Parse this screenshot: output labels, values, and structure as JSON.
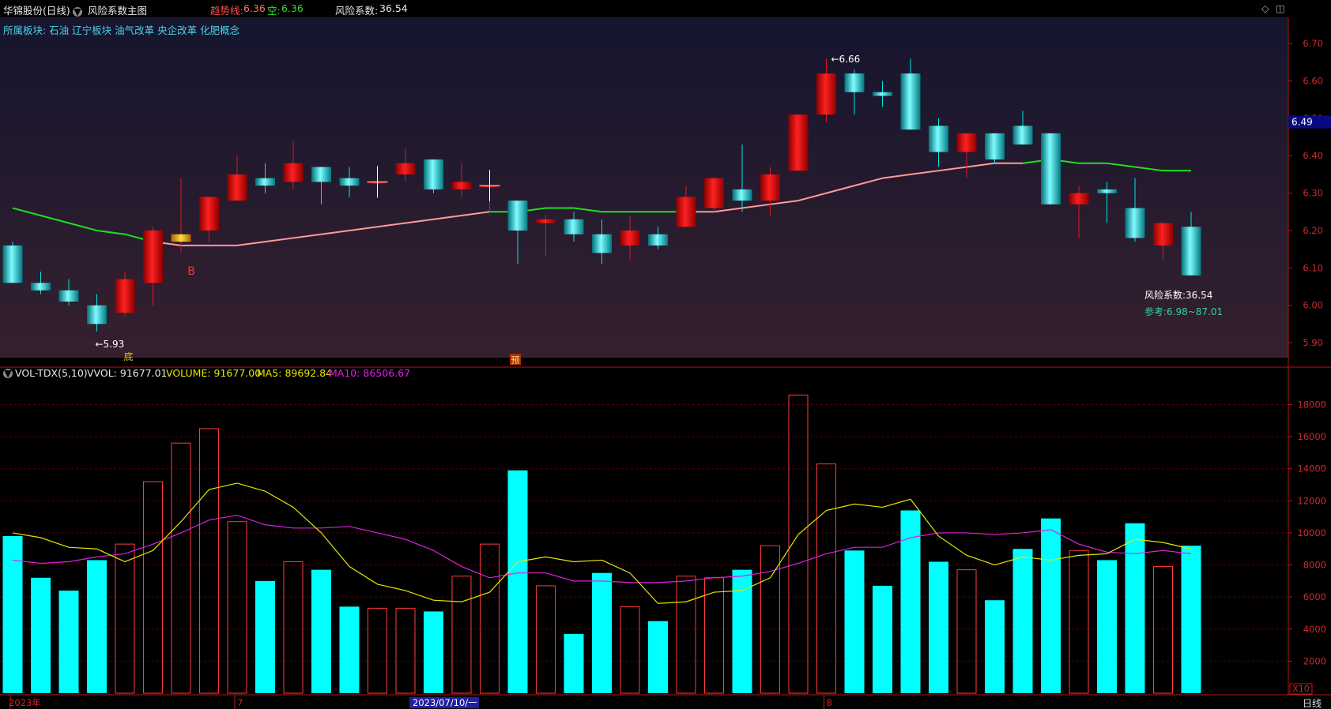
{
  "header": {
    "stock": "华锦股份(日线)",
    "indicator": "风险系数主图",
    "trend_label": "趋势线:",
    "trend_value": "6.36",
    "short_label": "空:",
    "short_value": "6.36",
    "risk_label": "风险系数:",
    "risk_value": "36.54"
  },
  "sectors": "所属板块:  石油  辽宁板块  油气改革  央企改革  化肥概念",
  "vol_header": {
    "name": "VOL-TDX(5,10)",
    "vvol": "VVOL: 91677.01",
    "volume": "VOLUME: 91677.00",
    "ma5": "MA5: 89692.84",
    "ma10": "MA10: 86506.67"
  },
  "colors": {
    "up": "#e01818",
    "down": "#00e6e6",
    "vol_up": "#ff3b3b",
    "vol_down": "#00ffff",
    "trend_up": "#ff9a9a",
    "trend_down": "#22dd22",
    "ma5": "#e6e600",
    "ma10": "#e020e0",
    "axis": "#c01818"
  },
  "chart_data": [
    {
      "type": "candlestick",
      "y_ticks": [
        5.9,
        6.0,
        6.1,
        6.2,
        6.3,
        6.4,
        6.5,
        6.6,
        6.7
      ],
      "ylim": [
        5.86,
        6.77
      ],
      "last_price_label": "6.49",
      "candles": [
        {
          "o": 6.16,
          "h": 6.17,
          "l": 6.06,
          "c": 6.06
        },
        {
          "o": 6.06,
          "h": 6.09,
          "l": 6.03,
          "c": 6.04
        },
        {
          "o": 6.04,
          "h": 6.07,
          "l": 6.0,
          "c": 6.01
        },
        {
          "o": 6.0,
          "h": 6.03,
          "l": 5.93,
          "c": 5.95
        },
        {
          "o": 5.98,
          "h": 6.09,
          "l": 5.97,
          "c": 6.07
        },
        {
          "o": 6.06,
          "h": 6.21,
          "l": 6.0,
          "c": 6.2
        },
        {
          "o": 6.17,
          "h": 6.34,
          "l": 6.14,
          "c": 6.19
        },
        {
          "o": 6.2,
          "h": 6.29,
          "l": 6.17,
          "c": 6.29
        },
        {
          "o": 6.28,
          "h": 6.4,
          "l": 6.28,
          "c": 6.35
        },
        {
          "o": 6.34,
          "h": 6.38,
          "l": 6.3,
          "c": 6.32
        },
        {
          "o": 6.33,
          "h": 6.44,
          "l": 6.31,
          "c": 6.38
        },
        {
          "o": 6.37,
          "h": 6.37,
          "l": 6.27,
          "c": 6.33
        },
        {
          "o": 6.34,
          "h": 6.37,
          "l": 6.29,
          "c": 6.32
        },
        {
          "o": 6.33,
          "h": 6.36,
          "l": 6.29,
          "c": 6.33
        },
        {
          "o": 6.35,
          "h": 6.42,
          "l": 6.33,
          "c": 6.38
        },
        {
          "o": 6.39,
          "h": 6.39,
          "l": 6.3,
          "c": 6.31
        },
        {
          "o": 6.31,
          "h": 6.38,
          "l": 6.29,
          "c": 6.33
        },
        {
          "o": 6.32,
          "h": 6.36,
          "l": 6.25,
          "c": 6.32
        },
        {
          "o": 6.28,
          "h": 6.28,
          "l": 6.11,
          "c": 6.2
        },
        {
          "o": 6.22,
          "h": 6.24,
          "l": 6.13,
          "c": 6.23
        },
        {
          "o": 6.23,
          "h": 6.25,
          "l": 6.17,
          "c": 6.19
        },
        {
          "o": 6.19,
          "h": 6.23,
          "l": 6.11,
          "c": 6.14
        },
        {
          "o": 6.16,
          "h": 6.24,
          "l": 6.12,
          "c": 6.2
        },
        {
          "o": 6.19,
          "h": 6.21,
          "l": 6.15,
          "c": 6.16
        },
        {
          "o": 6.21,
          "h": 6.32,
          "l": 6.21,
          "c": 6.29
        },
        {
          "o": 6.26,
          "h": 6.31,
          "l": 6.25,
          "c": 6.34
        },
        {
          "o": 6.31,
          "h": 6.43,
          "l": 6.25,
          "c": 6.28
        },
        {
          "o": 6.28,
          "h": 6.37,
          "l": 6.24,
          "c": 6.35
        },
        {
          "o": 6.36,
          "h": 6.51,
          "l": 6.36,
          "c": 6.51
        },
        {
          "o": 6.51,
          "h": 6.66,
          "l": 6.49,
          "c": 6.62
        },
        {
          "o": 6.62,
          "h": 6.63,
          "l": 6.51,
          "c": 6.57
        },
        {
          "o": 6.57,
          "h": 6.6,
          "l": 6.53,
          "c": 6.56
        },
        {
          "o": 6.62,
          "h": 6.66,
          "l": 6.47,
          "c": 6.47
        },
        {
          "o": 6.48,
          "h": 6.5,
          "l": 6.37,
          "c": 6.41
        },
        {
          "o": 6.41,
          "h": 6.46,
          "l": 6.34,
          "c": 6.46
        },
        {
          "o": 6.46,
          "h": 6.46,
          "l": 6.38,
          "c": 6.39
        },
        {
          "o": 6.48,
          "h": 6.52,
          "l": 6.43,
          "c": 6.43
        },
        {
          "o": 6.46,
          "h": 6.46,
          "l": 6.27,
          "c": 6.27
        },
        {
          "o": 6.27,
          "h": 6.32,
          "l": 6.18,
          "c": 6.3
        },
        {
          "o": 6.31,
          "h": 6.33,
          "l": 6.22,
          "c": 6.3
        },
        {
          "o": 6.26,
          "h": 6.34,
          "l": 6.17,
          "c": 6.18
        },
        {
          "o": 6.16,
          "h": 6.22,
          "l": 6.12,
          "c": 6.22
        },
        {
          "o": 6.21,
          "h": 6.25,
          "l": 6.08,
          "c": 6.08
        }
      ],
      "trend_line": [
        6.26,
        6.24,
        6.22,
        6.2,
        6.19,
        6.17,
        6.16,
        6.16,
        6.16,
        6.17,
        6.18,
        6.19,
        6.2,
        6.21,
        6.22,
        6.23,
        6.24,
        6.25,
        6.25,
        6.26,
        6.26,
        6.25,
        6.25,
        6.25,
        6.25,
        6.25,
        6.26,
        6.27,
        6.28,
        6.3,
        6.32,
        6.34,
        6.35,
        6.36,
        6.37,
        6.38,
        6.38,
        6.39,
        6.38,
        6.38,
        6.37,
        6.36,
        6.36
      ],
      "trend_color_split": [
        5,
        6,
        17,
        24
      ],
      "crosses": [
        {
          "i": 13,
          "p": 6.33
        },
        {
          "i": 17,
          "p": 6.32
        }
      ],
      "annotations": {
        "low": {
          "index": 3,
          "price": 5.93,
          "text": "←5.93",
          "tag": "底"
        },
        "high": {
          "index": 29,
          "price": 6.66,
          "text": "←6.66"
        },
        "buy": {
          "index": 6,
          "price": 6.09,
          "text": "B"
        },
        "risk_text": "风险系数:36.54",
        "ref_text": "参考:6.98~87.01",
        "yu": "预"
      }
    },
    {
      "type": "bar",
      "y_ticks": [
        2000,
        4000,
        6000,
        8000,
        10000,
        12000,
        14000,
        16000,
        18000
      ],
      "ylim": [
        0,
        19500
      ],
      "unit": "X10",
      "volumes": [
        9800,
        7200,
        6400,
        8300,
        9300,
        13200,
        15600,
        16500,
        10700,
        7000,
        8200,
        7700,
        5400,
        5300,
        5300,
        5100,
        7300,
        9300,
        13900,
        6700,
        3700,
        7500,
        5400,
        4500,
        7300,
        7200,
        7700,
        9200,
        18600,
        14300,
        8900,
        6700,
        11400,
        8200,
        7700,
        5800,
        9000,
        10900,
        8900,
        8300,
        10600,
        7900,
        9200
      ],
      "ma5": [
        10000,
        9700,
        9100,
        9000,
        8200,
        8900,
        10700,
        12700,
        13100,
        12600,
        11600,
        10000,
        7900,
        6800,
        6400,
        5800,
        5700,
        6300,
        8200,
        8500,
        8200,
        8300,
        7500,
        5600,
        5700,
        6300,
        6400,
        7200,
        9900,
        11400,
        11800,
        11600,
        12100,
        9800,
        8600,
        8000,
        8500,
        8300,
        8600,
        8700,
        9600,
        9400,
        9000
      ],
      "ma10": [
        8300,
        8100,
        8200,
        8500,
        8700,
        9300,
        10000,
        10800,
        11100,
        10500,
        10300,
        10300,
        10400,
        10000,
        9600,
        8900,
        7900,
        7200,
        7500,
        7500,
        7000,
        7000,
        6900,
        6900,
        7000,
        7200,
        7300,
        7600,
        8100,
        8700,
        9100,
        9100,
        9700,
        10000,
        10000,
        9900,
        10000,
        10200,
        9300,
        8800,
        8700,
        8900,
        8700
      ]
    }
  ],
  "x_axis": {
    "labels": [
      {
        "index": 0,
        "text": "2023年"
      },
      {
        "index": 8,
        "text": "7"
      },
      {
        "index": 29,
        "text": "8"
      }
    ],
    "cursor": {
      "index": 14,
      "text": "2023/07/10/一"
    },
    "period": "日线"
  }
}
